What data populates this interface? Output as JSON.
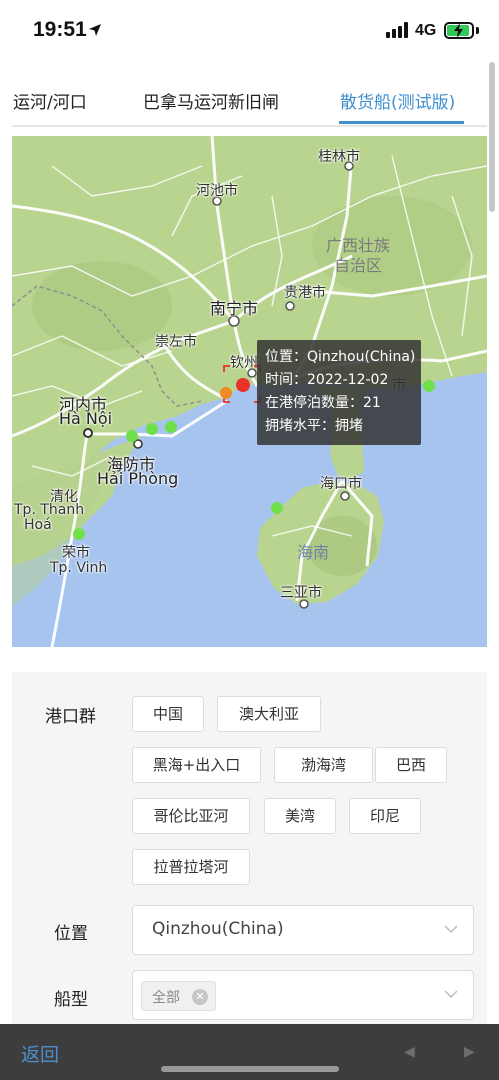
{
  "status_bar": {
    "time": "19:51",
    "network": "4G"
  },
  "tabs": [
    {
      "label": "运河/河口",
      "active": false
    },
    {
      "label": "巴拿马运河新旧闸",
      "active": false
    },
    {
      "label": "散货船(测试版)",
      "active": true
    }
  ],
  "map": {
    "labels": {
      "guilin": "桂林市",
      "hechi": "河池市",
      "guangxi": "广西壮族",
      "zizhiqu": "自治区",
      "guigang": "贵港市",
      "nanning": "南宁市",
      "chongzuo": "崇左市",
      "qinzhou": "钦州",
      "hanoi_cn": "河内市",
      "hanoi_vi": "Hà Nội",
      "haiphong_cn": "海防市",
      "haiphong_vi": "Hải Phòng",
      "thanhhoa_cn": "清化",
      "thanhhoa_vi": "Tp. Thanh",
      "thanhhoa_vi2": "Hoá",
      "vinh_cn": "荣市",
      "vinh_vi": "Tp. Vinh",
      "haikou": "海口市",
      "hainan": "海南",
      "sanya": "三亚市",
      "zhanjiang_fragment": "市"
    },
    "tooltip": {
      "location": "位置：Qinzhou(China)",
      "time": "时间：2022-12-02",
      "berth_count": "在港停泊数量：21",
      "congestion": "拥堵水平：拥堵"
    },
    "colors": {
      "congested": "#e8312a",
      "moderate": "#f08a24",
      "normal": "#6fe04a"
    }
  },
  "filters": {
    "port_group_label": "港口群",
    "port_groups": [
      "中国",
      "澳大利亚",
      "黑海+出入口",
      "渤海湾",
      "巴西",
      "哥伦比亚河",
      "美湾",
      "印尼",
      "拉普拉塔河"
    ],
    "location_label": "位置",
    "location_value": "Qinzhou(China)",
    "ship_type_label": "船型",
    "ship_type_tag": "全部"
  },
  "bottom_bar": {
    "back_label": "返回"
  }
}
